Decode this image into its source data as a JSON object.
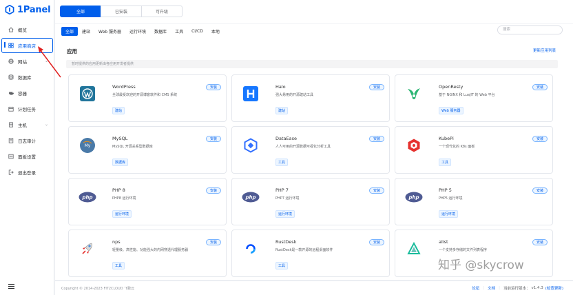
{
  "brand": {
    "name": "1Panel",
    "color": "#005eeb"
  },
  "sidebar": {
    "items": [
      {
        "icon": "home-icon",
        "label": "概览",
        "chevron": false
      },
      {
        "icon": "grid-icon",
        "label": "应用商店",
        "chevron": false
      },
      {
        "icon": "globe-icon",
        "label": "网站",
        "chevron": true
      },
      {
        "icon": "database-icon",
        "label": "数据库",
        "chevron": false
      },
      {
        "icon": "container-icon",
        "label": "容器",
        "chevron": false
      },
      {
        "icon": "calendar-icon",
        "label": "计划任务",
        "chevron": false
      },
      {
        "icon": "host-icon",
        "label": "主机",
        "chevron": true
      },
      {
        "icon": "log-icon",
        "label": "日志审计",
        "chevron": false
      },
      {
        "icon": "settings-icon",
        "label": "面板设置",
        "chevron": false
      },
      {
        "icon": "logout-icon",
        "label": "退出登录",
        "chevron": false
      }
    ]
  },
  "top_tabs": [
    "全部",
    "已安装",
    "可升级"
  ],
  "filters": [
    "全部",
    "建站",
    "Web 服务器",
    "运行环境",
    "数据库",
    "工具",
    "CI/CD",
    "本地"
  ],
  "search": {
    "placeholder": "搜索"
  },
  "section": {
    "title": "应用",
    "sync_link": "更新应用列表",
    "hint": "暂时提供的应用更新由各应用开发者提供"
  },
  "install_label": "安装",
  "apps": [
    {
      "name": "WordPress",
      "desc": "全球最受欢迎的开源博客软件和 CMS 系统",
      "tag": "建站",
      "icon": "wordpress-icon"
    },
    {
      "name": "Halo",
      "desc": "强大易用的开源建站工具",
      "tag": "建站",
      "icon": "halo-icon"
    },
    {
      "name": "OpenResty",
      "desc": "基于 NGINX 和 LuaJIT 的 Web 平台",
      "tag": "Web 服务器",
      "icon": "openresty-icon"
    },
    {
      "name": "MySQL",
      "desc": "MySQL 开源关系型数据库",
      "tag": "数据库",
      "icon": "mysql-icon"
    },
    {
      "name": "DataEase",
      "desc": "人人可用的开源数据可视化分析工具",
      "tag": "工具",
      "icon": "dataease-icon"
    },
    {
      "name": "KubePi",
      "desc": "一个现代化的 K8s 面板",
      "tag": "工具",
      "icon": "kubepi-icon"
    },
    {
      "name": "PHP 8",
      "desc": "PHP8 运行环境",
      "tag": "运行环境",
      "icon": "php-icon"
    },
    {
      "name": "PHP 7",
      "desc": "PHP7 运行环境",
      "tag": "运行环境",
      "icon": "php-icon"
    },
    {
      "name": "PHP 5",
      "desc": "PHP5 运行环境",
      "tag": "运行环境",
      "icon": "php-icon"
    },
    {
      "name": "nps",
      "desc": "轻量级、高性能、功能强大的内网穿透代理服务器",
      "tag": "工具",
      "icon": "nps-icon"
    },
    {
      "name": "RustDesk",
      "desc": "RustDesk是一款开源的远程桌面软件",
      "tag": "工具",
      "icon": "rustdesk-icon"
    },
    {
      "name": "alist",
      "desc": "一个支持多存储的文件列表程序",
      "tag": "",
      "icon": "alist-icon"
    }
  ],
  "footer": {
    "copyright": "Copyright © 2014-2023 FIT2CLOUD 飞致云",
    "forum": "论坛",
    "docs": "文档",
    "version_label": "当前运行版本：",
    "version": "v1.4.3",
    "check_update": "(检查更新)"
  },
  "watermark": "知乎 @skycrow"
}
